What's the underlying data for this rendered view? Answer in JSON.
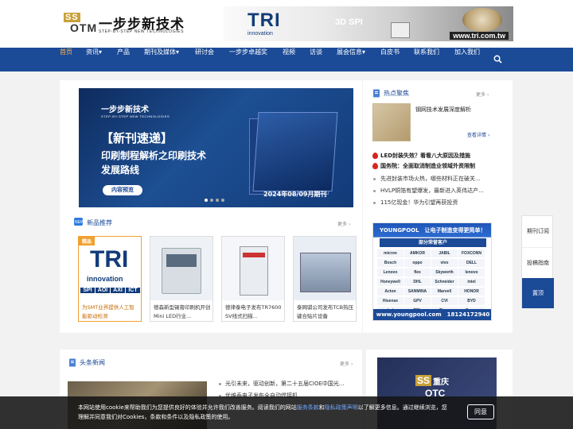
{
  "header": {
    "logo_ss": "SS",
    "logo_otm": "OTM",
    "logo_cn": "一步步新技术",
    "logo_en": "STEP-BY-STEP NEW TECHNOLOGIES",
    "ad": {
      "brand": "TRI",
      "brand_sub": "innovation",
      "product": "3D SPI",
      "url": "www.tri.com.tw"
    }
  },
  "nav": {
    "items": [
      "首页",
      "资讯",
      "产品",
      "期刊及媒体",
      "研讨会",
      "一步步卓越奖",
      "视频",
      "访谈",
      "展会信息",
      "白皮书",
      "联系我们",
      "加入我们"
    ],
    "active_index": 0,
    "dropdown_indices": [
      1,
      3,
      8
    ],
    "search_icon": "search-icon"
  },
  "banner": {
    "logo": "一步步新技术",
    "logo_en": "STEP-BY-STEP NEW TECHNOLOGIES",
    "tag": "【新刊速递】",
    "line1": "印刷制程解析之印刷技术",
    "line2": "发展路线",
    "button": "内容预览",
    "issue": "2024年08/09月期刊",
    "slide_count": 4,
    "active_slide": 0
  },
  "products": {
    "title": "新品推荐",
    "more": "更多",
    "cards": [
      {
        "badge": "精品",
        "tags": [
          "SPI",
          "AOI",
          "AXI",
          "ICT"
        ],
        "brand": "TRI",
        "brand_sub": "innovation",
        "caption": "为SMT业界提供人工智能驱动检测",
        "highlight": true
      },
      {
        "caption": "德森新型锡膏印刷机开创Mini LED行业...",
        "highlight": false
      },
      {
        "caption": "德律泰电子发布TR7600 SV线式扫描...",
        "highlight": false
      },
      {
        "caption": "泰网骐公司发布TCB热压键合贴片设备",
        "highlight": false
      }
    ]
  },
  "hot": {
    "title": "热点聚焦",
    "more": "更多",
    "featured": "钢网技术发展深度解析",
    "detail_link": "查看详情",
    "fire_items": [
      "LED封装失效？看看八大原因及措施",
      "国务院：全面取消制造业领域外资限制"
    ],
    "items": [
      "先进封装市场火热，哪些材料正在破关...",
      "HVLP铜箔有望爆发，最新进入英伟达产...",
      "115亿现金！华为引望再获投资"
    ]
  },
  "youngpool_ad": {
    "brand": "YOUNGPOOL",
    "slogan": "让电子制造变得更简单！",
    "subtitle": "部分荣誉客户",
    "logos": [
      "micron",
      "AMKOR",
      "JABIL",
      "FOXCONN",
      "Bosch",
      "oppo",
      "vivo",
      "DELL",
      "Lenovo",
      "flex",
      "Skyworth",
      "lenovo",
      "Honeywell",
      "DHL",
      "Schneider",
      "intel",
      "Acton",
      "SANMINA",
      "Marvell",
      "HONOR",
      "Hisense",
      "GPV",
      "CVI",
      "BYD",
      "imi",
      "TCL",
      "Cisco",
      "Canon"
    ],
    "url": "www.youngpool.com",
    "phone": "18124172940"
  },
  "side": {
    "items": [
      "期刊订阅",
      "投稿指南",
      "置顶"
    ]
  },
  "headline": {
    "title": "头条新闻",
    "more": "更多",
    "items": [
      "光引未来，驱动创新，第二十五届CIOE中国光...",
      "优维泰电子发布全自动焊接机"
    ]
  },
  "chongqing_ad": {
    "ss": "SS",
    "name": "重庆",
    "otc": "OTC"
  },
  "cookie": {
    "text_before": "本网站使用cookie来帮助我们为您提供良好的体验并允许我们改善服务。阅读我们的网站",
    "link1": "服务条款",
    "and": "和",
    "link2": "隐私政策声明",
    "text_after": "以了解更多信息。通过继续浏览，您理解并同意我们对Cookies，条款和条件以及隐私政策的使用。",
    "button": "同意"
  }
}
